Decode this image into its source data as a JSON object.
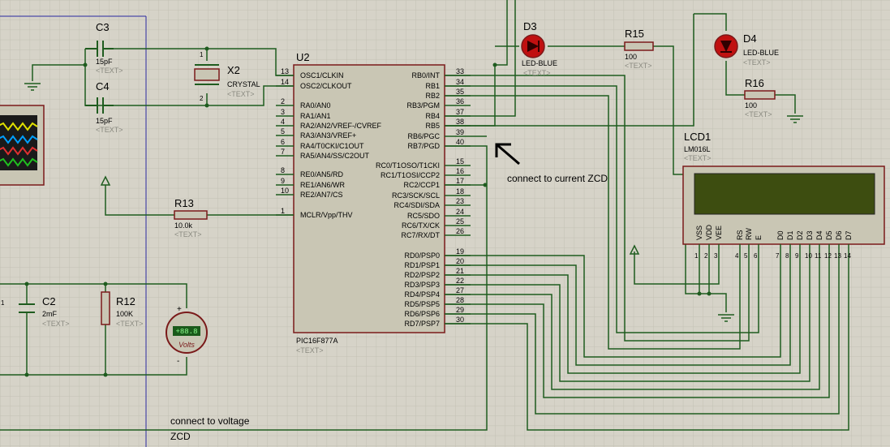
{
  "colors": {
    "background": "#d6d3c8",
    "grid": "#c3c0b4",
    "wire": "#1f5c1f",
    "chip_fill": "#c9c6b4",
    "chip_border": "#7a1a1a",
    "lcd_screen": "#3d4d10",
    "led_red": "#c01010",
    "border_blue": "#2a2aa0"
  },
  "icons": [
    "ground-icon",
    "power-arrow-icon",
    "crystal-icon",
    "capacitor-icon",
    "resistor-icon",
    "led-icon",
    "voltmeter-icon",
    "oscilloscope-icon",
    "cursor-arrow-icon"
  ],
  "components": {
    "C3": {
      "ref": "C3",
      "value": "15pF",
      "text": "<TEXT>"
    },
    "C4": {
      "ref": "C4",
      "value": "15pF",
      "text": "<TEXT>"
    },
    "X2": {
      "ref": "X2",
      "value": "CRYSTAL",
      "text": "<TEXT>",
      "pin1": "1",
      "pin2": "2"
    },
    "U2": {
      "ref": "U2",
      "part": "PIC16F877A",
      "text": "<TEXT>"
    },
    "D3": {
      "ref": "D3",
      "value": "LED-BLUE",
      "text": "<TEXT>"
    },
    "D4": {
      "ref": "D4",
      "value": "LED-BLUE",
      "text": "<TEXT>"
    },
    "R15": {
      "ref": "R15",
      "value": "100",
      "text": "<TEXT>"
    },
    "R16": {
      "ref": "R16",
      "value": "100",
      "text": "<TEXT>"
    },
    "R13": {
      "ref": "R13",
      "value": "10.0k",
      "text": "<TEXT>"
    },
    "R12": {
      "ref": "R12",
      "value": "100K",
      "text": "<TEXT>"
    },
    "C2": {
      "ref": "C2",
      "value": "2mF",
      "text": "<TEXT>",
      "left_pin": "1"
    },
    "LCD1": {
      "ref": "LCD1",
      "part": "LM016L",
      "text": "<TEXT>"
    },
    "voltmeter": {
      "reading": "+88.8",
      "unit": "Volts",
      "plus": "+",
      "minus": "-"
    }
  },
  "pic_left_pins": [
    {
      "num": "13",
      "label": "OSC1/CLKIN"
    },
    {
      "num": "14",
      "label": "OSC2/CLKOUT"
    },
    {
      "num": "2",
      "label": "RA0/AN0"
    },
    {
      "num": "3",
      "label": "RA1/AN1"
    },
    {
      "num": "4",
      "label": "RA2/AN2/VREF-/CVREF"
    },
    {
      "num": "5",
      "label": "RA3/AN3/VREF+"
    },
    {
      "num": "6",
      "label": "RA4/T0CKI/C1OUT"
    },
    {
      "num": "7",
      "label": "RA5/AN4/SS/C2OUT"
    },
    {
      "num": "8",
      "label": "RE0/AN5/RD"
    },
    {
      "num": "9",
      "label": "RE1/AN6/WR"
    },
    {
      "num": "10",
      "label": "RE2/AN7/CS"
    },
    {
      "num": "1",
      "label": "MCLR/Vpp/THV"
    }
  ],
  "pic_right_pins": [
    {
      "num": "33",
      "label": "RB0/INT"
    },
    {
      "num": "34",
      "label": "RB1"
    },
    {
      "num": "35",
      "label": "RB2"
    },
    {
      "num": "36",
      "label": "RB3/PGM"
    },
    {
      "num": "37",
      "label": "RB4"
    },
    {
      "num": "38",
      "label": "RB5"
    },
    {
      "num": "39",
      "label": "RB6/PGC"
    },
    {
      "num": "40",
      "label": "RB7/PGD"
    },
    {
      "num": "15",
      "label": "RC0/T1OSO/T1CKI"
    },
    {
      "num": "16",
      "label": "RC1/T1OSI/CCP2"
    },
    {
      "num": "17",
      "label": "RC2/CCP1"
    },
    {
      "num": "18",
      "label": "RC3/SCK/SCL"
    },
    {
      "num": "23",
      "label": "RC4/SDI/SDA"
    },
    {
      "num": "24",
      "label": "RC5/SDO"
    },
    {
      "num": "25",
      "label": "RC6/TX/CK"
    },
    {
      "num": "26",
      "label": "RC7/RX/DT"
    },
    {
      "num": "19",
      "label": "RD0/PSP0"
    },
    {
      "num": "20",
      "label": "RD1/PSP1"
    },
    {
      "num": "21",
      "label": "RD2/PSP2"
    },
    {
      "num": "22",
      "label": "RD3/PSP3"
    },
    {
      "num": "27",
      "label": "RD4/PSP4"
    },
    {
      "num": "28",
      "label": "RD5/PSP5"
    },
    {
      "num": "29",
      "label": "RD6/PSP6"
    },
    {
      "num": "30",
      "label": "RD7/PSP7"
    }
  ],
  "lcd_pins": [
    {
      "num": "1",
      "label": "VSS"
    },
    {
      "num": "2",
      "label": "VDD"
    },
    {
      "num": "3",
      "label": "VEE"
    },
    {
      "num": "4",
      "label": "RS"
    },
    {
      "num": "5",
      "label": "RW"
    },
    {
      "num": "6",
      "label": "E"
    },
    {
      "num": "7",
      "label": "D0"
    },
    {
      "num": "8",
      "label": "D1"
    },
    {
      "num": "9",
      "label": "D2"
    },
    {
      "num": "10",
      "label": "D3"
    },
    {
      "num": "11",
      "label": "D4"
    },
    {
      "num": "12",
      "label": "D5"
    },
    {
      "num": "13",
      "label": "D6"
    },
    {
      "num": "14",
      "label": "D7"
    }
  ],
  "notes": {
    "current_zcd": "connect to current ZCD",
    "voltage_zcd_line1": "connect to voltage",
    "voltage_zcd_line2": "ZCD"
  }
}
